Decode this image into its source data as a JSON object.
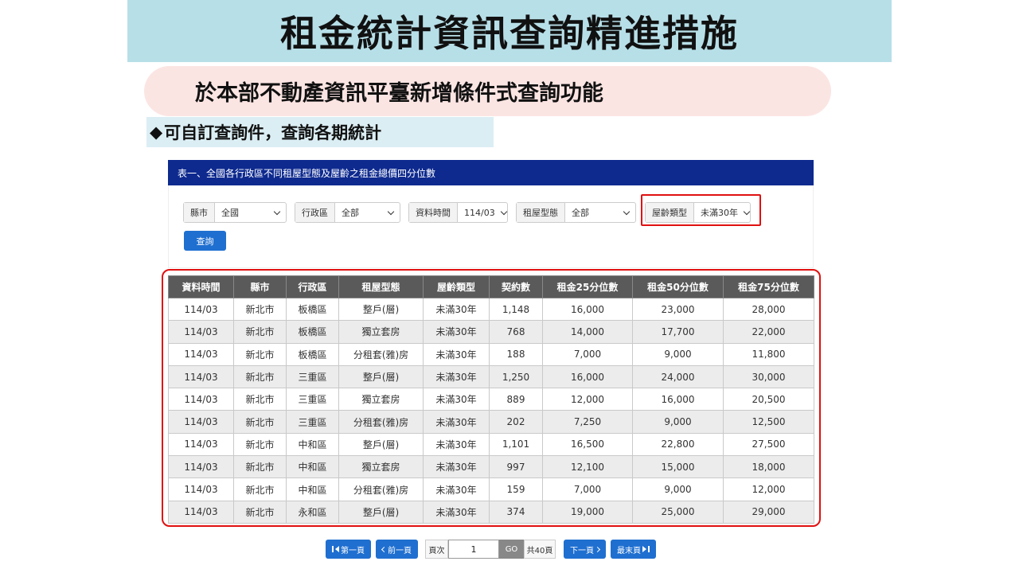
{
  "slide": {
    "title": "租金統計資訊查詢精進措施",
    "subtitle": "於本部不動產資訊平臺新增條件式查詢功能",
    "bullet_symbol": "◆",
    "bullet": "可自訂查詢件，查詢各期統計"
  },
  "panel": {
    "title": "表一、全國各行政區不同租屋型態及屋齡之租金總價四分位數",
    "filters": [
      {
        "label": "縣市",
        "value": "全國"
      },
      {
        "label": "行政區",
        "value": "全部"
      },
      {
        "label": "資料時間",
        "value": "114/03"
      },
      {
        "label": "租屋型態",
        "value": "全部"
      },
      {
        "label": "屋齡類型",
        "value": "未滿30年"
      }
    ],
    "query_button": "查詢"
  },
  "table": {
    "headers": [
      "資料時間",
      "縣市",
      "行政區",
      "租屋型態",
      "屋齡類型",
      "契約數",
      "租金25分位數",
      "租金50分位數",
      "租金75分位數"
    ],
    "rows": [
      [
        "114/03",
        "新北市",
        "板橋區",
        "整戶(層)",
        "未滿30年",
        "1,148",
        "16,000",
        "23,000",
        "28,000"
      ],
      [
        "114/03",
        "新北市",
        "板橋區",
        "獨立套房",
        "未滿30年",
        "768",
        "14,000",
        "17,700",
        "22,000"
      ],
      [
        "114/03",
        "新北市",
        "板橋區",
        "分租套(雅)房",
        "未滿30年",
        "188",
        "7,000",
        "9,000",
        "11,800"
      ],
      [
        "114/03",
        "新北市",
        "三重區",
        "整戶(層)",
        "未滿30年",
        "1,250",
        "16,000",
        "24,000",
        "30,000"
      ],
      [
        "114/03",
        "新北市",
        "三重區",
        "獨立套房",
        "未滿30年",
        "889",
        "12,000",
        "16,000",
        "20,500"
      ],
      [
        "114/03",
        "新北市",
        "三重區",
        "分租套(雅)房",
        "未滿30年",
        "202",
        "7,250",
        "9,000",
        "12,500"
      ],
      [
        "114/03",
        "新北市",
        "中和區",
        "整戶(層)",
        "未滿30年",
        "1,101",
        "16,500",
        "22,800",
        "27,500"
      ],
      [
        "114/03",
        "新北市",
        "中和區",
        "獨立套房",
        "未滿30年",
        "997",
        "12,100",
        "15,000",
        "18,000"
      ],
      [
        "114/03",
        "新北市",
        "中和區",
        "分租套(雅)房",
        "未滿30年",
        "159",
        "7,000",
        "9,000",
        "12,000"
      ],
      [
        "114/03",
        "新北市",
        "永和區",
        "整戶(層)",
        "未滿30年",
        "374",
        "19,000",
        "25,000",
        "29,000"
      ]
    ]
  },
  "pagination": {
    "first": "第一頁",
    "prev": "前一頁",
    "page_label": "頁次",
    "page_value": "1",
    "go": "GO",
    "total": "共40頁",
    "next": "下一頁",
    "last": "最末頁"
  },
  "colors": {
    "title_bg": "#b7dfe8",
    "subtitle_bg": "#fbe5e3",
    "panel_header": "#0e2a8f",
    "button": "#1f6fd0",
    "highlight": "#e01010"
  }
}
